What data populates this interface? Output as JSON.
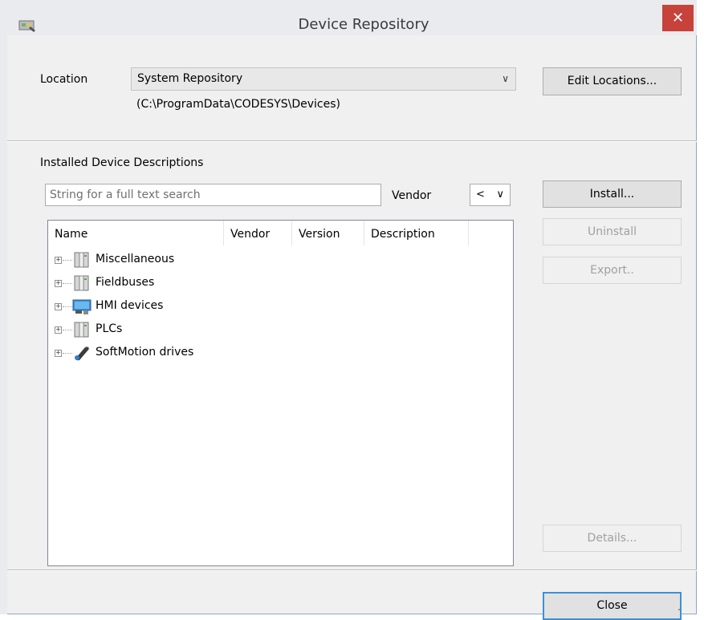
{
  "window": {
    "title": "Device Repository",
    "close_glyph": "✕",
    "app_icon": "device-repository-icon"
  },
  "location": {
    "label": "Location",
    "selected": "System Repository",
    "path": "(C:\\ProgramData\\CODESYS\\Devices)",
    "edit_button": "Edit Locations..."
  },
  "installed": {
    "heading": "Installed Device Descriptions",
    "search_placeholder": "String for a full text search",
    "vendor_label": "Vendor",
    "vendor_selected": "<",
    "columns": [
      "Name",
      "Vendor",
      "Version",
      "Description"
    ],
    "items": [
      {
        "label": "Miscellaneous",
        "icon": "device-module-icon"
      },
      {
        "label": "Fieldbuses",
        "icon": "device-module-icon"
      },
      {
        "label": "HMI devices",
        "icon": "hmi-monitor-icon"
      },
      {
        "label": "PLCs",
        "icon": "device-module-icon"
      },
      {
        "label": "SoftMotion drives",
        "icon": "softmotion-drive-icon"
      }
    ]
  },
  "buttons": {
    "install": "Install...",
    "uninstall": "Uninstall",
    "export": "Export..",
    "details": "Details...",
    "close": "Close"
  },
  "colors": {
    "title_close_bg": "#c7423b",
    "default_button_border": "#3d8fd6",
    "window_bg": "#f0f0f0"
  }
}
